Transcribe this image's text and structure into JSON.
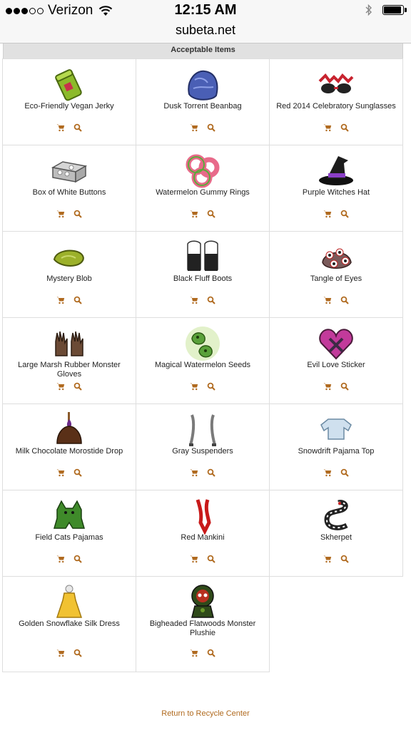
{
  "status_bar": {
    "carrier": "Verizon",
    "time": "12:15 AM"
  },
  "browser": {
    "url": "subeta.net"
  },
  "table": {
    "header": "Acceptable Items"
  },
  "items": [
    {
      "name": "Eco-Friendly Vegan Jerky",
      "icon": "jerky-icon"
    },
    {
      "name": "Dusk Torrent Beanbag",
      "icon": "beanbag-icon"
    },
    {
      "name": "Red 2014 Celebratory Sunglasses",
      "icon": "sunglasses-icon"
    },
    {
      "name": "Box of White Buttons",
      "icon": "button-box-icon"
    },
    {
      "name": "Watermelon Gummy Rings",
      "icon": "gummy-rings-icon"
    },
    {
      "name": "Purple Witches Hat",
      "icon": "witch-hat-icon"
    },
    {
      "name": "Mystery Blob",
      "icon": "blob-icon"
    },
    {
      "name": "Black Fluff Boots",
      "icon": "boots-icon"
    },
    {
      "name": "Tangle of Eyes",
      "icon": "eyes-icon"
    },
    {
      "name": "Large Marsh Rubber Monster Gloves",
      "icon": "gloves-icon"
    },
    {
      "name": "Magical Watermelon Seeds",
      "icon": "seeds-icon"
    },
    {
      "name": "Evil Love Sticker",
      "icon": "sticker-icon"
    },
    {
      "name": "Milk Chocolate Morostide Drop",
      "icon": "chocolate-drop-icon"
    },
    {
      "name": "Gray Suspenders",
      "icon": "suspenders-icon"
    },
    {
      "name": "Snowdrift Pajama Top",
      "icon": "pajama-top-icon"
    },
    {
      "name": "Field Cats Pajamas",
      "icon": "cat-pajamas-icon"
    },
    {
      "name": "Red Mankini",
      "icon": "mankini-icon"
    },
    {
      "name": "Skherpet",
      "icon": "snake-icon"
    },
    {
      "name": "Golden Snowflake Silk Dress",
      "icon": "dress-icon"
    },
    {
      "name": "Bigheaded Flatwoods Monster Plushie",
      "icon": "plushie-icon"
    }
  ],
  "footer": {
    "return_link": "Return to Recycle Center"
  },
  "colors": {
    "accent": "#b06a1f",
    "header_bg": "#e1e1e1",
    "border": "#dedede"
  }
}
